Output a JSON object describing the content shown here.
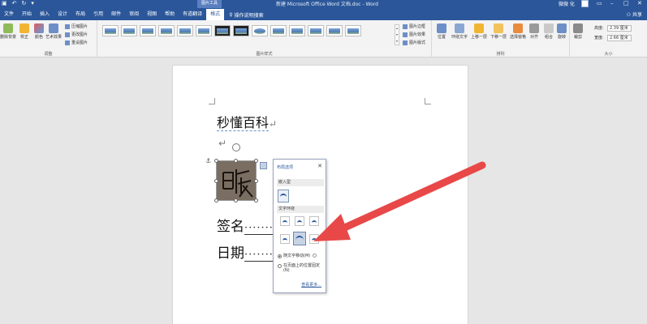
{
  "window": {
    "title": "新建 Microsoft Office Word 文档.doc - Word",
    "context_group": "图片工具",
    "user": "微微 化",
    "share": "共享"
  },
  "tabs": [
    {
      "label": "文件"
    },
    {
      "label": "开始"
    },
    {
      "label": "插入"
    },
    {
      "label": "设计"
    },
    {
      "label": "布局"
    },
    {
      "label": "引用"
    },
    {
      "label": "邮件"
    },
    {
      "label": "审阅"
    },
    {
      "label": "视图"
    },
    {
      "label": "帮助"
    },
    {
      "label": "有道翻译"
    },
    {
      "label": "格式",
      "active": true
    }
  ],
  "tell_me": "操作说明搜索",
  "ribbon": {
    "adjust": {
      "label": "调整",
      "remove_bg": "删除背景",
      "corrections": "校正",
      "color": "颜色",
      "artistic": "艺术效果",
      "compress": "压缩图片",
      "change": "更改图片",
      "reset": "重设图片"
    },
    "styles": {
      "label": "图片样式",
      "border": "图片边框",
      "effects": "图片效果",
      "layout": "图片版式"
    },
    "arrange": {
      "label": "排列",
      "position": "位置",
      "wrap": "环绕文字",
      "forward": "上移一层",
      "backward": "下移一层",
      "selection_pane": "选择窗格",
      "align": "对齐",
      "group": "组合",
      "rotate": "旋转"
    },
    "size": {
      "label": "大小",
      "crop": "裁剪",
      "height_label": "高度:",
      "height_value": "2.39 厘米",
      "width_label": "宽度:",
      "width_value": "2.66 厘米"
    }
  },
  "document": {
    "heading": "秒懂百科",
    "signature_label": "签名",
    "date_label": "日期",
    "picture_text": "百度"
  },
  "layout_popup": {
    "title": "布局选项",
    "inline_section": "嵌入型",
    "wrap_section": "文字环绕",
    "radio_move": "随文字移动(M)",
    "radio_fix": "在页面上的位置固定(N)",
    "see_more": "查看更多..."
  },
  "colors": {
    "accent": "#2b579a",
    "arrow": "#e84848"
  }
}
